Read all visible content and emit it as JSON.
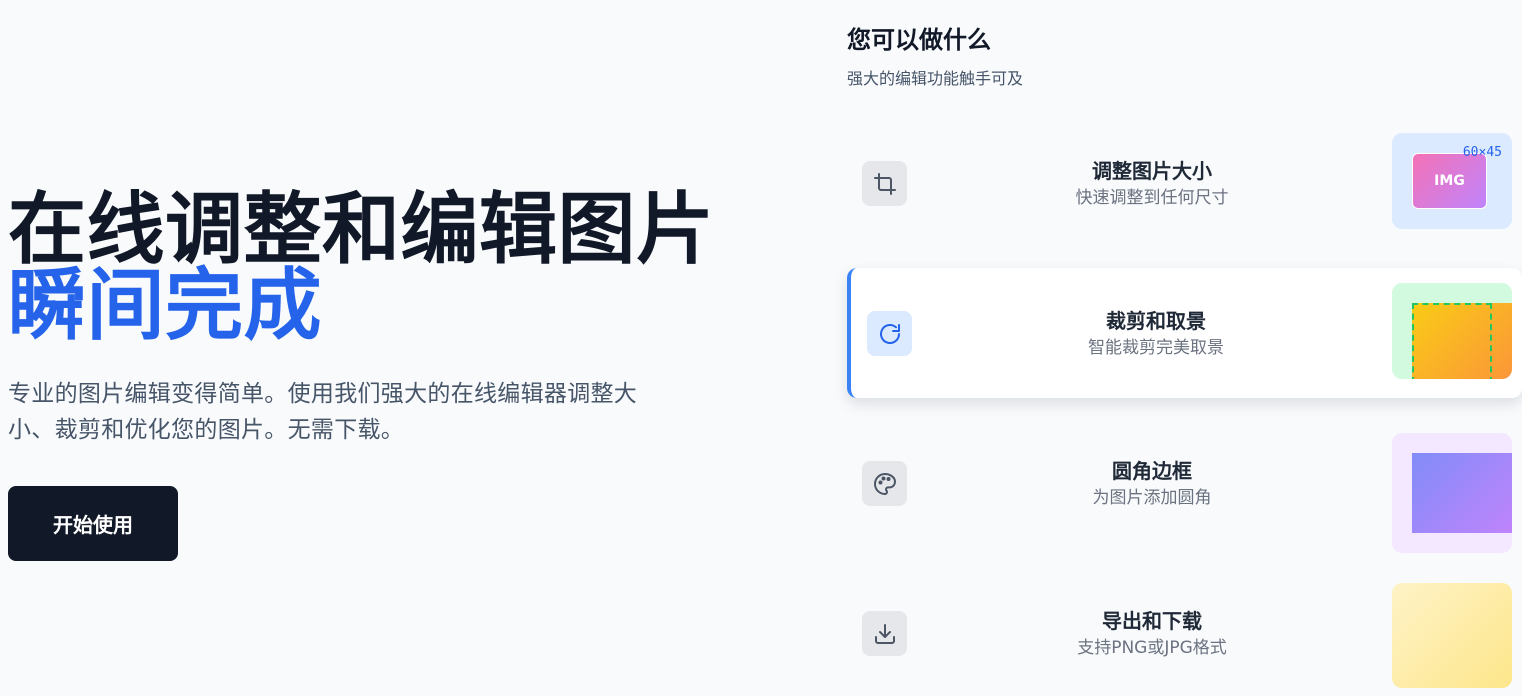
{
  "hero": {
    "ghost_text": "",
    "title_line1": "在线调整和编辑图片",
    "title_line2": "瞬间完成",
    "description": "专业的图片编辑变得简单。使用我们强大的在线编辑器调整大小、裁剪和优化您的图片。无需下载。",
    "cta_label": "开始使用"
  },
  "features": {
    "title": "您可以做什么",
    "subtitle": "强大的编辑功能触手可及",
    "items": [
      {
        "title": "调整图片大小",
        "desc": "快速调整到任何尺寸",
        "icon": "crop-icon",
        "preview_label": "IMG",
        "preview_dims": "60×45",
        "active": false
      },
      {
        "title": "裁剪和取景",
        "desc": "智能裁剪完美取景",
        "icon": "rotate-icon",
        "active": true
      },
      {
        "title": "圆角边框",
        "desc": "为图片添加圆角",
        "icon": "palette-icon",
        "active": false
      },
      {
        "title": "导出和下载",
        "desc": "支持PNG或JPG格式",
        "icon": "download-icon",
        "active": false
      }
    ]
  },
  "colors": {
    "accent": "#2563eb",
    "dark": "#111827",
    "background": "#f8fafc"
  }
}
